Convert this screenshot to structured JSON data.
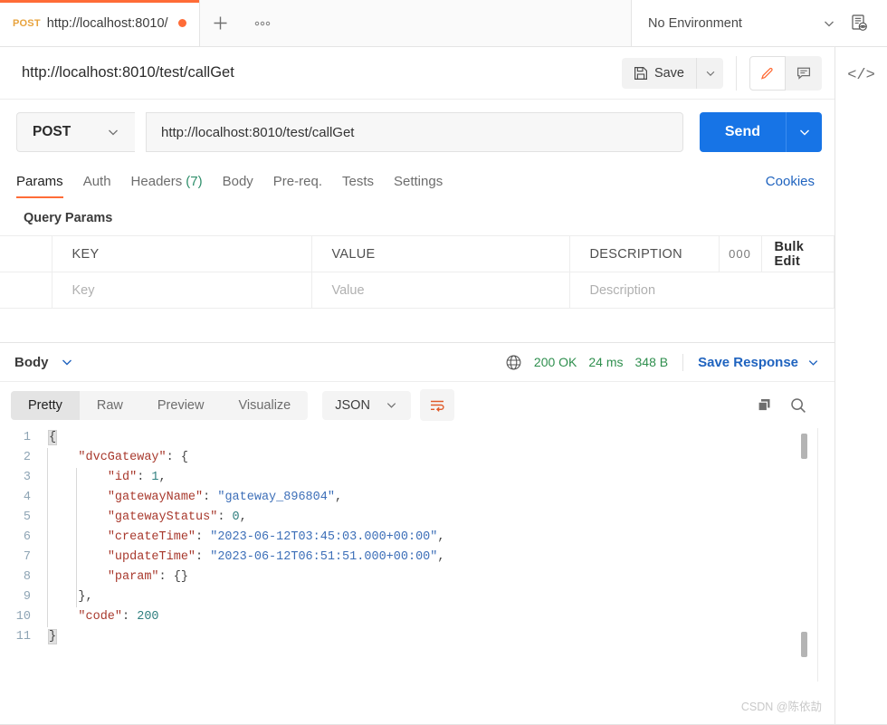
{
  "tabstrip": {
    "request_tab": {
      "method": "POST",
      "name": "http://localhost:8010/",
      "unsaved_icon": "unsaved-dot"
    },
    "new_tab_icon": "plus-icon",
    "more_tabs_icon": "ellipsis-icon",
    "environment": {
      "selected": "No Environment",
      "caret_icon": "chevron-down-icon",
      "quick_look_icon": "environment-quick-look-icon"
    }
  },
  "rail": {
    "code_icon": "code-snippet-icon"
  },
  "request_header": {
    "title": "http://localhost:8010/test/callGet",
    "save_label": "Save",
    "save_icon": "floppy-disk-icon",
    "save_caret_icon": "chevron-down-icon",
    "edit_icon": "pencil-icon",
    "comment_icon": "comment-icon"
  },
  "url_bar": {
    "method": "POST",
    "method_caret_icon": "chevron-down-icon",
    "url": "http://localhost:8010/test/callGet",
    "send_label": "Send",
    "send_caret_icon": "chevron-down-icon"
  },
  "request_tabs": {
    "items": [
      {
        "label": "Params",
        "count": "",
        "active": true
      },
      {
        "label": "Auth",
        "count": "",
        "active": false
      },
      {
        "label": "Headers",
        "count": "(7)",
        "active": false
      },
      {
        "label": "Body",
        "count": "",
        "active": false
      },
      {
        "label": "Pre-req.",
        "count": "",
        "active": false
      },
      {
        "label": "Tests",
        "count": "",
        "active": false
      },
      {
        "label": "Settings",
        "count": "",
        "active": false
      }
    ],
    "cookies_label": "Cookies"
  },
  "query_params": {
    "section_label": "Query Params",
    "headers": {
      "key": "KEY",
      "value": "VALUE",
      "description": "DESCRIPTION"
    },
    "more_icon": "ellipsis-icon",
    "bulk_edit_label": "Bulk Edit",
    "placeholder_row": {
      "key": "Key",
      "value": "Value",
      "description": "Description"
    }
  },
  "response": {
    "body_label": "Body",
    "body_caret_icon": "chevron-down-icon",
    "globe_icon": "globe-icon",
    "status": "200 OK",
    "time": "24 ms",
    "size": "348 B",
    "save_response_label": "Save Response",
    "save_response_caret_icon": "chevron-down-icon",
    "view_tabs": [
      {
        "label": "Pretty",
        "active": true
      },
      {
        "label": "Raw",
        "active": false
      },
      {
        "label": "Preview",
        "active": false
      },
      {
        "label": "Visualize",
        "active": false
      }
    ],
    "format": "JSON",
    "format_caret_icon": "chevron-down-icon",
    "wrap_icon": "word-wrap-icon",
    "copy_icon": "copy-icon",
    "search_icon": "search-icon",
    "line_numbers": [
      "1",
      "2",
      "3",
      "4",
      "5",
      "6",
      "7",
      "8",
      "9",
      "10",
      "11"
    ],
    "json_lines": [
      {
        "indent": 0,
        "tokens": [
          {
            "t": "p",
            "v": "{"
          }
        ]
      },
      {
        "indent": 1,
        "tokens": [
          {
            "t": "k",
            "v": "\"dvcGateway\""
          },
          {
            "t": "p",
            "v": ": {"
          }
        ]
      },
      {
        "indent": 2,
        "tokens": [
          {
            "t": "k",
            "v": "\"id\""
          },
          {
            "t": "p",
            "v": ": "
          },
          {
            "t": "n",
            "v": "1"
          },
          {
            "t": "p",
            "v": ","
          }
        ]
      },
      {
        "indent": 2,
        "tokens": [
          {
            "t": "k",
            "v": "\"gatewayName\""
          },
          {
            "t": "p",
            "v": ": "
          },
          {
            "t": "s",
            "v": "\"gateway_896804\""
          },
          {
            "t": "p",
            "v": ","
          }
        ]
      },
      {
        "indent": 2,
        "tokens": [
          {
            "t": "k",
            "v": "\"gatewayStatus\""
          },
          {
            "t": "p",
            "v": ": "
          },
          {
            "t": "n",
            "v": "0"
          },
          {
            "t": "p",
            "v": ","
          }
        ]
      },
      {
        "indent": 2,
        "tokens": [
          {
            "t": "k",
            "v": "\"createTime\""
          },
          {
            "t": "p",
            "v": ": "
          },
          {
            "t": "s",
            "v": "\"2023-06-12T03:45:03.000+00:00\""
          },
          {
            "t": "p",
            "v": ","
          }
        ]
      },
      {
        "indent": 2,
        "tokens": [
          {
            "t": "k",
            "v": "\"updateTime\""
          },
          {
            "t": "p",
            "v": ": "
          },
          {
            "t": "s",
            "v": "\"2023-06-12T06:51:51.000+00:00\""
          },
          {
            "t": "p",
            "v": ","
          }
        ]
      },
      {
        "indent": 2,
        "tokens": [
          {
            "t": "k",
            "v": "\"param\""
          },
          {
            "t": "p",
            "v": ": {}"
          }
        ]
      },
      {
        "indent": 1,
        "tokens": [
          {
            "t": "p",
            "v": "},"
          }
        ]
      },
      {
        "indent": 1,
        "tokens": [
          {
            "t": "k",
            "v": "\"code\""
          },
          {
            "t": "p",
            "v": ": "
          },
          {
            "t": "n",
            "v": "200"
          }
        ]
      },
      {
        "indent": 0,
        "tokens": [
          {
            "t": "p",
            "v": "}"
          }
        ]
      }
    ]
  },
  "watermark": "CSDN @陈依劼",
  "colors": {
    "accent_orange": "#ff6c37",
    "send_blue": "#1774e6",
    "link_blue": "#1f63bf",
    "status_green": "#2f8f4e",
    "header_count_green": "#2f8f6b",
    "json_key": "#a8392d",
    "json_string": "#3d6fb8",
    "json_number": "#2f7f7f"
  }
}
